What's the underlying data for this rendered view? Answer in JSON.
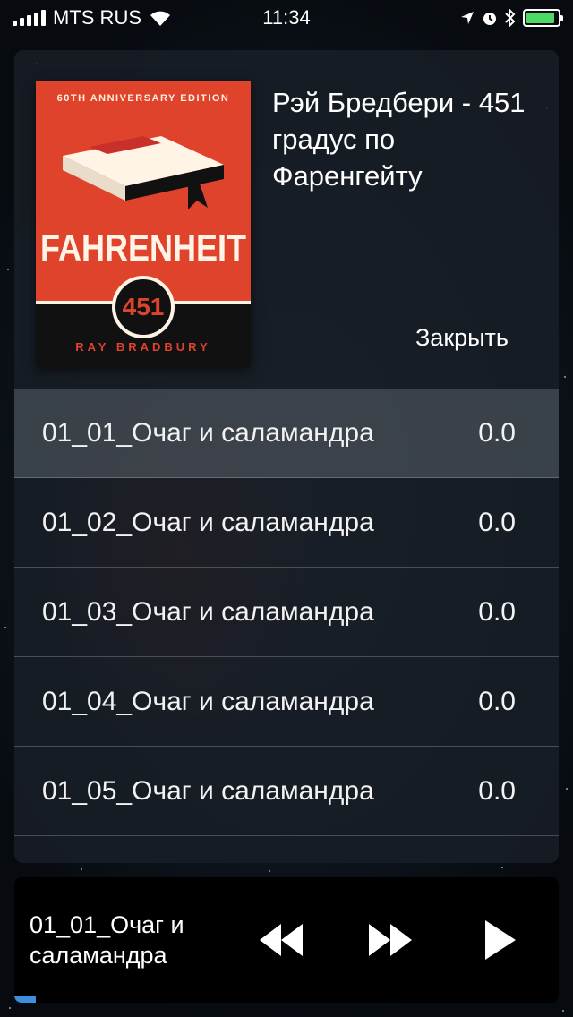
{
  "status_bar": {
    "carrier": "MTS RUS",
    "time": "11:34",
    "battery_level": 0.9,
    "icons": [
      "signal-icon",
      "wifi-icon",
      "location-icon",
      "alarm-icon",
      "bluetooth-icon",
      "battery-icon"
    ]
  },
  "book": {
    "title": "Рэй Бредбери - 451 градус по Фаренгейту",
    "close_label": "Закрыть",
    "cover": {
      "edition": "60TH ANNIVERSARY EDITION",
      "title": "FAHRENHEIT",
      "number": "451",
      "author": "RAY BRADBURY"
    }
  },
  "tracks": [
    {
      "name": "01_01_Очаг и саламандра",
      "value": "0.0"
    },
    {
      "name": "01_02_Очаг и саламандра",
      "value": "0.0"
    },
    {
      "name": "01_03_Очаг и саламандра",
      "value": "0.0"
    },
    {
      "name": "01_04_Очаг и саламандра",
      "value": "0.0"
    },
    {
      "name": "01_05_Очаг и саламандра",
      "value": "0.0"
    }
  ],
  "active_track_index": 0,
  "player": {
    "now_playing": "01_01_Очаг и саламандра",
    "progress": 0.04,
    "controls": [
      "rewind-icon",
      "fast-forward-icon",
      "play-icon"
    ]
  },
  "colors": {
    "accent": "#3d8fdc",
    "battery": "#4cd964",
    "cover_red": "#e0432c"
  }
}
